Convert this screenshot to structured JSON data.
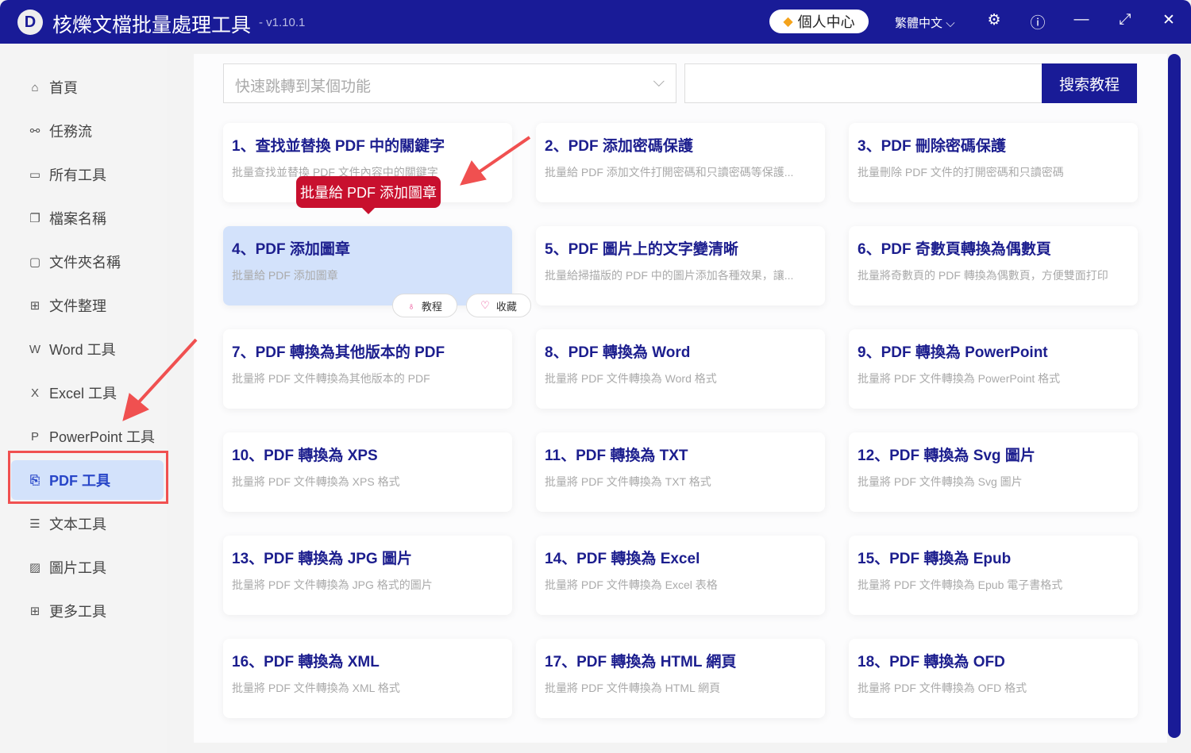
{
  "app": {
    "title": "核爍文檔批量處理工具",
    "version": "- v1.10.1",
    "user_center": "個人中心",
    "language": "繁體中文"
  },
  "sidebar": {
    "items": [
      {
        "label": "首頁",
        "icon": "home-icon"
      },
      {
        "label": "任務流",
        "icon": "workflow-icon"
      },
      {
        "label": "所有工具",
        "icon": "monitor-icon"
      },
      {
        "label": "檔案名稱",
        "icon": "file-name-icon"
      },
      {
        "label": "文件夾名稱",
        "icon": "folder-icon"
      },
      {
        "label": "文件整理",
        "icon": "organize-icon"
      },
      {
        "label": "Word 工具",
        "icon": "word-icon"
      },
      {
        "label": "Excel 工具",
        "icon": "excel-icon"
      },
      {
        "label": "PowerPoint 工具",
        "icon": "ppt-icon"
      },
      {
        "label": "PDF 工具",
        "icon": "pdf-icon",
        "active": true
      },
      {
        "label": "文本工具",
        "icon": "text-icon"
      },
      {
        "label": "圖片工具",
        "icon": "image-icon"
      },
      {
        "label": "更多工具",
        "icon": "grid-icon"
      }
    ]
  },
  "search": {
    "dropdown_placeholder": "快速跳轉到某個功能",
    "input_value": "",
    "button": "搜索教程"
  },
  "tooltip": "批量給 PDF 添加圖章",
  "card_actions": {
    "tutorial": "教程",
    "favorite": "收藏"
  },
  "cards": [
    {
      "title": "1、查找並替換 PDF 中的關鍵字",
      "desc": "批量查找並替換 PDF 文件內容中的關鍵字"
    },
    {
      "title": "2、PDF 添加密碼保護",
      "desc": "批量給 PDF 添加文件打開密碼和只讀密碼等保護..."
    },
    {
      "title": "3、PDF 刪除密碼保護",
      "desc": "批量刪除 PDF 文件的打開密碼和只讀密碼"
    },
    {
      "title": "4、PDF 添加圖章",
      "desc": "批量給 PDF 添加圖章"
    },
    {
      "title": "5、PDF 圖片上的文字變清晰",
      "desc": "批量給掃描版的 PDF 中的圖片添加各種效果，讓..."
    },
    {
      "title": "6、PDF 奇數頁轉換為偶數頁",
      "desc": "批量將奇數頁的 PDF 轉換為偶數頁，方便雙面打印"
    },
    {
      "title": "7、PDF 轉換為其他版本的 PDF",
      "desc": "批量將 PDF 文件轉換為其他版本的 PDF"
    },
    {
      "title": "8、PDF 轉換為 Word",
      "desc": "批量將 PDF 文件轉換為 Word 格式"
    },
    {
      "title": "9、PDF 轉換為 PowerPoint",
      "desc": "批量將 PDF 文件轉換為 PowerPoint 格式"
    },
    {
      "title": "10、PDF 轉換為 XPS",
      "desc": "批量將 PDF 文件轉換為 XPS 格式"
    },
    {
      "title": "11、PDF 轉換為 TXT",
      "desc": "批量將 PDF 文件轉換為 TXT 格式"
    },
    {
      "title": "12、PDF 轉換為 Svg 圖片",
      "desc": "批量將 PDF 文件轉換為 Svg 圖片"
    },
    {
      "title": "13、PDF 轉換為 JPG 圖片",
      "desc": "批量將 PDF 文件轉換為 JPG 格式的圖片"
    },
    {
      "title": "14、PDF 轉換為 Excel",
      "desc": "批量將 PDF 文件轉換為 Excel 表格"
    },
    {
      "title": "15、PDF 轉換為 Epub",
      "desc": "批量將 PDF 文件轉換為 Epub 電子書格式"
    },
    {
      "title": "16、PDF 轉換為 XML",
      "desc": "批量將 PDF 文件轉換為 XML 格式"
    },
    {
      "title": "17、PDF 轉換為 HTML 網頁",
      "desc": "批量將 PDF 文件轉換為 HTML 網頁"
    },
    {
      "title": "18、PDF 轉換為 OFD",
      "desc": "批量將 PDF 文件轉換為 OFD 格式"
    }
  ],
  "colors": {
    "brand": "#191b97",
    "title_text": "#1c1e8e",
    "highlight": "#d3e2fb",
    "tooltip": "#c8102e",
    "annotation": "#f05050"
  }
}
